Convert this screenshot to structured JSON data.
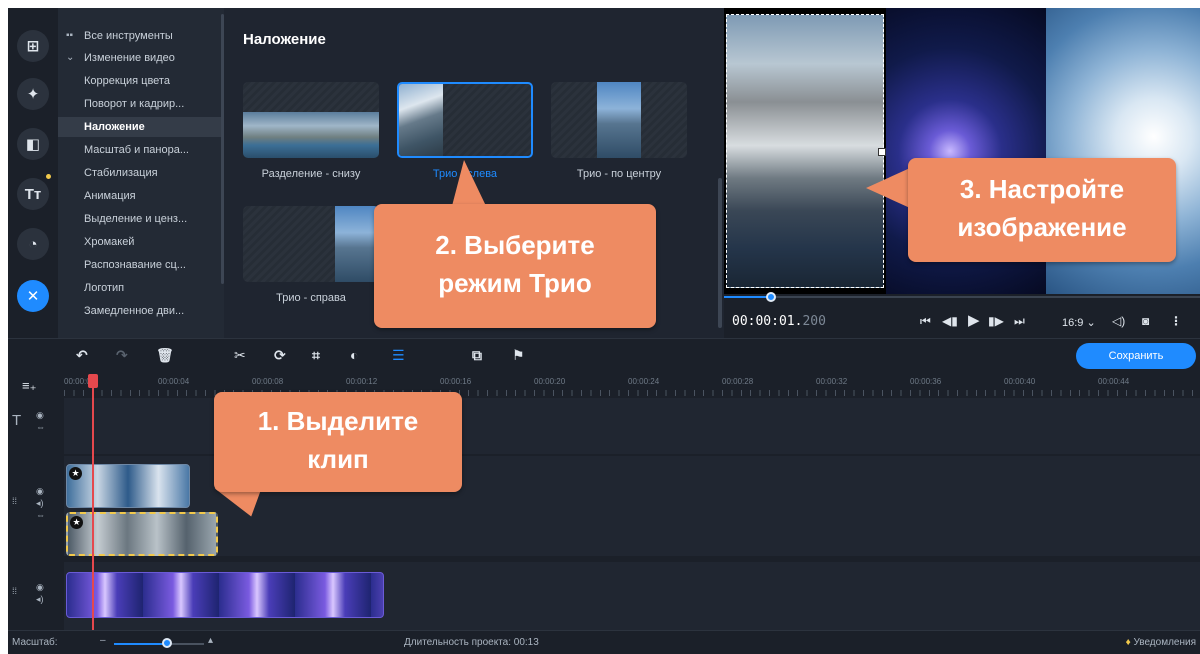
{
  "tools": {
    "all_tools": "Все инструменты",
    "video_edit": "Изменение видео",
    "items": [
      "Коррекция цвета",
      "Поворот и кадрир...",
      "Наложение",
      "Масштаб и панора...",
      "Стабилизация",
      "Анимация",
      "Выделение и ценз...",
      "Хромакей",
      "Распознавание сц...",
      "Логотип",
      "Замедленное дви..."
    ],
    "selected": "Наложение"
  },
  "overlay": {
    "title": "Наложение",
    "thumbs": [
      "Разделение - снизу",
      "Трио - слева",
      "Трио - по центру",
      "Трио - справа"
    ]
  },
  "player": {
    "time_main": "00:00:01.",
    "time_dim": "200",
    "aspect": "16:9"
  },
  "toolbar": {
    "save_label": "Сохранить"
  },
  "ruler": {
    "labels": [
      "00:00:00",
      "00:00:04",
      "00:00:08",
      "00:00:12",
      "00:00:16",
      "00:00:20",
      "00:00:24",
      "00:00:28",
      "00:00:32",
      "00:00:36",
      "00:00:40",
      "00:00:44"
    ]
  },
  "status": {
    "zoom_label": "Масштаб:",
    "duration": "Длительность проекта: 00:13",
    "notifications": "Уведомления"
  },
  "callouts": {
    "step1_line1": "1. Выделите",
    "step1_line2": "клип",
    "step2_line1": "2. Выберите",
    "step2_line2": "режим Трио",
    "step3_line1": "3. Настройте",
    "step3_line2": "изображение"
  },
  "colors": {
    "accent": "#1f8bff",
    "callout": "#ee8b62",
    "playhead": "#e5484d",
    "selected_clip_border": "#f2c94c"
  }
}
